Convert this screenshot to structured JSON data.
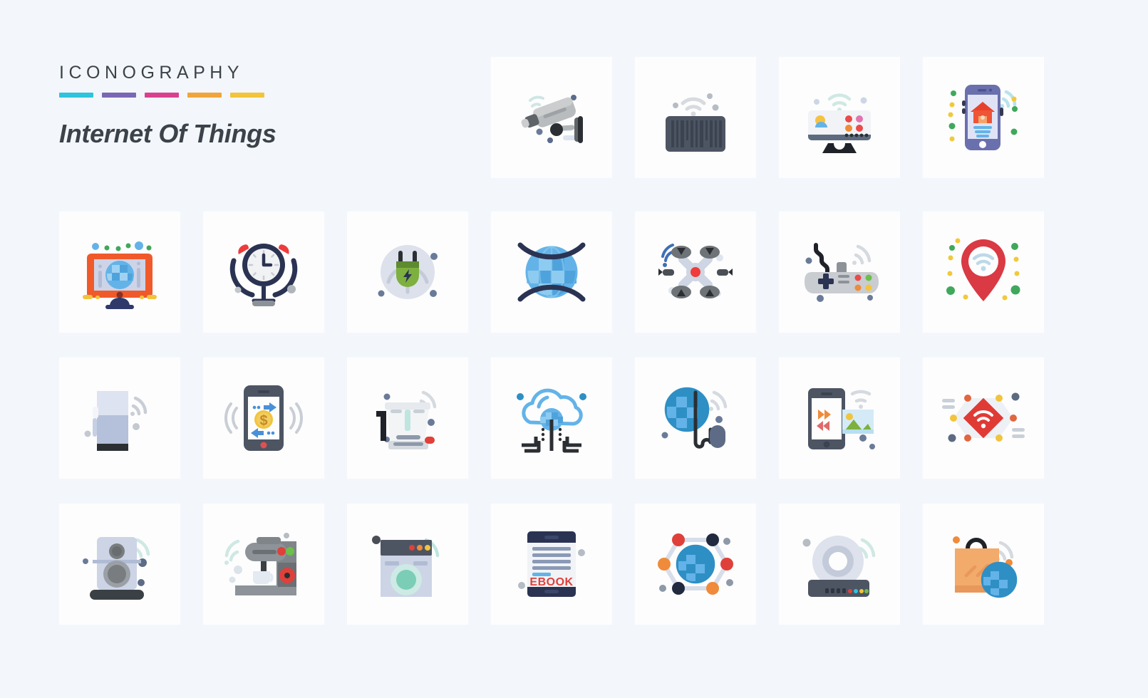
{
  "page": {
    "background_color": "#f3f7fc",
    "card_color": "#fdfdfd"
  },
  "header": {
    "brand": "ICONOGRAPHY",
    "subtitle": "Internet Of Things",
    "bar_colors": [
      "#2ec4dd",
      "#7b68b5",
      "#d9418f",
      "#f0a53c",
      "#f2c43c"
    ],
    "text_color": "#3b4249"
  },
  "grid": {
    "rows": 4,
    "columns": 8,
    "card_size": 170,
    "row_tops": [
      80,
      297,
      502,
      707
    ],
    "col_lefts": [
      83,
      285,
      487,
      689,
      891,
      1093,
      1295,
      1314
    ],
    "note": "Row 1 occupies only columns 5-8; header fills columns 1-4"
  },
  "icons": [
    {
      "row": 1,
      "col": 5,
      "name": "cctv-security-camera",
      "label": "CCTV Camera"
    },
    {
      "row": 1,
      "col": 6,
      "name": "barcode-scanner",
      "label": "Barcode Scanner"
    },
    {
      "row": 1,
      "col": 7,
      "name": "smart-tv-weather-monitor",
      "label": "Smart TV Dashboard"
    },
    {
      "row": 1,
      "col": 8,
      "name": "smartphone-smart-home-app",
      "label": "Smart Home App"
    },
    {
      "row": 2,
      "col": 1,
      "name": "monitor-globe-internet",
      "label": "Internet Monitor"
    },
    {
      "row": 2,
      "col": 2,
      "name": "alarm-clock",
      "label": "Alarm Clock"
    },
    {
      "row": 2,
      "col": 3,
      "name": "electric-plug-power",
      "label": "Smart Plug"
    },
    {
      "row": 2,
      "col": 4,
      "name": "globe-network-arcs",
      "label": "Global Network"
    },
    {
      "row": 2,
      "col": 5,
      "name": "drone-quadcopter",
      "label": "Drone"
    },
    {
      "row": 2,
      "col": 6,
      "name": "game-controller-gamepad",
      "label": "Game Controller"
    },
    {
      "row": 2,
      "col": 7,
      "name": "location-pin-wifi",
      "label": "Wifi Location"
    },
    {
      "row": 3,
      "col": 1,
      "name": "smart-refrigerator",
      "label": "Smart Fridge"
    },
    {
      "row": 3,
      "col": 2,
      "name": "mobile-payment-dollar",
      "label": "Mobile Payment"
    },
    {
      "row": 3,
      "col": 3,
      "name": "smart-blender-kettle",
      "label": "Smart Blender"
    },
    {
      "row": 3,
      "col": 4,
      "name": "cloud-computing-network",
      "label": "Cloud Computing"
    },
    {
      "row": 3,
      "col": 5,
      "name": "globe-mouse-internet",
      "label": "Internet Browsing"
    },
    {
      "row": 3,
      "col": 6,
      "name": "mobile-image-transfer",
      "label": "Image Transfer"
    },
    {
      "row": 3,
      "col": 7,
      "name": "hexagon-wifi-network",
      "label": "Wifi Network"
    },
    {
      "row": 4,
      "col": 1,
      "name": "smart-speaker",
      "label": "Smart Speaker"
    },
    {
      "row": 4,
      "col": 2,
      "name": "coffee-machine",
      "label": "Smart Coffee Machine"
    },
    {
      "row": 4,
      "col": 3,
      "name": "washing-machine",
      "label": "Smart Washing Machine"
    },
    {
      "row": 4,
      "col": 4,
      "name": "ebook-tablet-reader",
      "label": "Ebook Reader"
    },
    {
      "row": 4,
      "col": 5,
      "name": "global-hexagon-network",
      "label": "Global Connectivity"
    },
    {
      "row": 4,
      "col": 6,
      "name": "wifi-router-modem",
      "label": "Router"
    },
    {
      "row": 4,
      "col": 7,
      "name": "online-shopping-bag-globe",
      "label": "Online Shopping"
    }
  ],
  "labels": {
    "ebook_text": "EBOOK",
    "dollar_symbol": "$"
  }
}
